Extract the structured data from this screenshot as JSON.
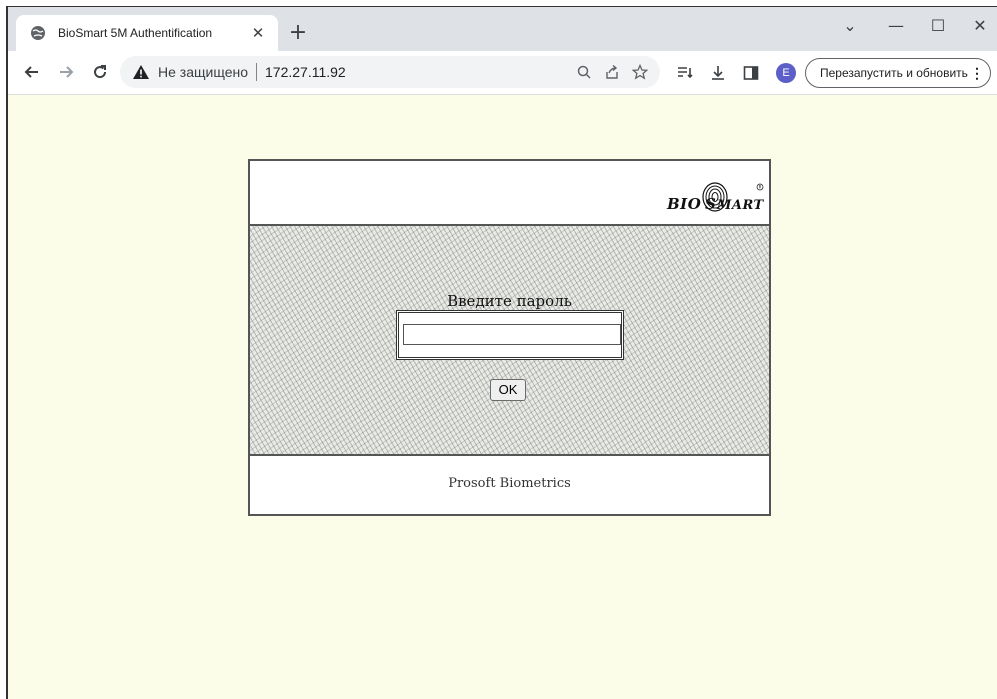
{
  "browser": {
    "tab": {
      "title": "BioSmart 5M Authentification",
      "favicon": "globe-icon",
      "close_icon": "close-icon"
    },
    "new_tab_icon": "plus-icon",
    "window_controls": [
      "chevron-down-icon",
      "minimize-icon",
      "maximize-icon",
      "close-icon"
    ],
    "toolbar": {
      "back_icon": "arrow-left-icon",
      "forward_icon": "arrow-right-icon",
      "reload_icon": "reload-icon",
      "security_icon": "warning-icon",
      "security_text": "Не защищено",
      "url": "172.27.11.92",
      "omnibox_icons": [
        "search-icon",
        "share-icon",
        "star-icon"
      ],
      "right_icons": [
        "reading-list-icon",
        "download-icon",
        "side-panel-icon"
      ],
      "avatar_letter": "E",
      "relaunch_label": "Перезапустить и обновить"
    }
  },
  "page": {
    "background_color": "#fbfde9",
    "logo_text": "BIOSMART",
    "prompt": "Введите пароль",
    "password_value": "",
    "ok_label": "OK",
    "footer": "Prosoft Biometrics"
  }
}
